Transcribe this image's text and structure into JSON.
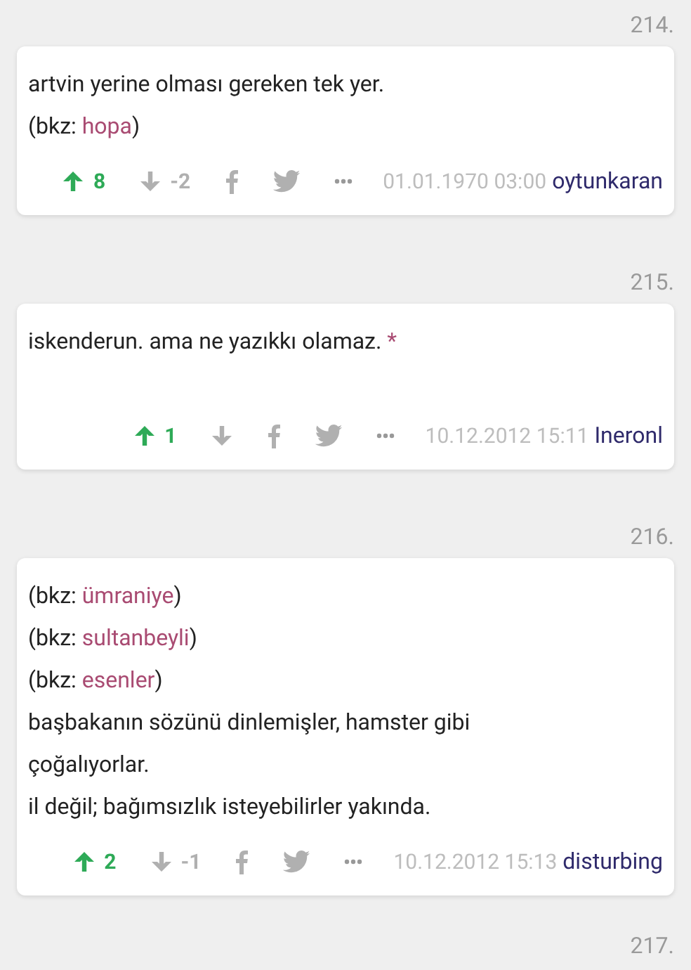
{
  "entries": [
    {
      "number": "214.",
      "lines": [
        [
          {
            "kind": "plain",
            "text": "artvin yerine olması gereken tek yer."
          }
        ],
        [
          {
            "kind": "plain",
            "text": "(bkz: "
          },
          {
            "kind": "link",
            "text": "hopa"
          },
          {
            "kind": "plain",
            "text": ")"
          }
        ]
      ],
      "upvote": {
        "count": "8",
        "active": true
      },
      "downvote": {
        "count": "-2",
        "active": false
      },
      "date": "01.01.1970 03:00",
      "author": "oytunkaran"
    },
    {
      "number": "215.",
      "lines": [
        [
          {
            "kind": "plain",
            "text": "iskenderun. ama ne yazıkkı olamaz. "
          },
          {
            "kind": "link",
            "text": "*"
          }
        ]
      ],
      "upvote": {
        "count": "1",
        "active": true
      },
      "downvote": {
        "active": false
      },
      "date": "10.12.2012 15:11",
      "author": "Ineronl"
    },
    {
      "number": "216.",
      "lines": [
        [
          {
            "kind": "plain",
            "text": "(bkz: "
          },
          {
            "kind": "link",
            "text": "ümraniye"
          },
          {
            "kind": "plain",
            "text": ")"
          }
        ],
        [
          {
            "kind": "plain",
            "text": "(bkz: "
          },
          {
            "kind": "link",
            "text": "sultanbeyli"
          },
          {
            "kind": "plain",
            "text": ")"
          }
        ],
        [
          {
            "kind": "plain",
            "text": "(bkz: "
          },
          {
            "kind": "link",
            "text": "esenler"
          },
          {
            "kind": "plain",
            "text": ")"
          }
        ],
        [
          {
            "kind": "plain",
            "text": "başbakanın sözünü dinlemişler, hamster gibi"
          }
        ],
        [
          {
            "kind": "plain",
            "text": "çoğalıyorlar."
          }
        ],
        [
          {
            "kind": "plain",
            "text": "il değil; bağımsızlık isteyebilirler yakında."
          }
        ]
      ],
      "upvote": {
        "count": "2",
        "active": true
      },
      "downvote": {
        "count": "-1",
        "active": false
      },
      "date": "10.12.2012 15:13",
      "author": "disturbing"
    },
    {
      "number": "217."
    }
  ]
}
